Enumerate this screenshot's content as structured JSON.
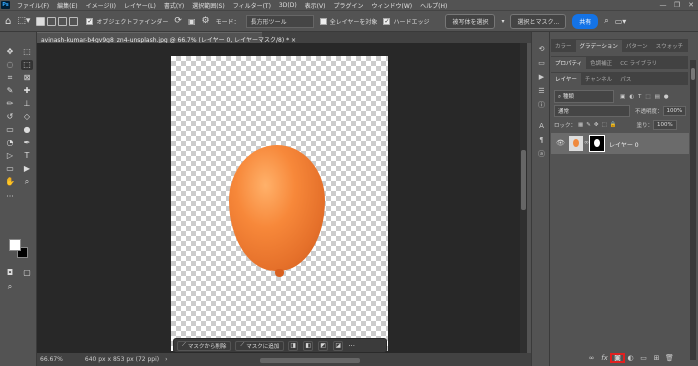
{
  "menu": {
    "logo": "Ps",
    "items": [
      "ファイル(F)",
      "編集(E)",
      "イメージ(I)",
      "レイヤー(L)",
      "書式(Y)",
      "選択範囲(S)",
      "フィルター(T)",
      "3D(D)",
      "表示(V)",
      "プラグイン",
      "ウィンドウ(W)",
      "ヘルプ(H)"
    ],
    "min": "—",
    "max": "❐",
    "close": "✕"
  },
  "options": {
    "object_finder": "オブジェクトファインダー",
    "mode_label": "モード：",
    "mode_value": "長方形ツール",
    "all_layers": "全レイヤーを対象",
    "hard_edge": "ハードエッジ",
    "select_subject": "被写体を選択",
    "select_mask": "選択とマスク...",
    "share": "共有"
  },
  "document": {
    "tab_title": "avinash-kumar-b4gv9g8_zn4-unsplash.jpg @ 66.7% (レイヤー 0, レイヤーマスク/8) *",
    "close": "×"
  },
  "mask_tools": {
    "subtract": "マスクから削除",
    "add": "マスクに追加",
    "more": "···"
  },
  "status": {
    "zoom": "66.67%",
    "doc_size": "640 px x 853 px (72 ppi)"
  },
  "panels": {
    "top_tabs": [
      "カラー",
      "グラデーション",
      "パターン",
      "スウォッチ"
    ],
    "mid_tabs": [
      "プロパティ",
      "色調補正",
      "CC ライブラリ"
    ],
    "layer_tabs": [
      "レイヤー",
      "チャンネル",
      "パス"
    ],
    "kind_label": "種類",
    "blend_mode": "通常",
    "opacity_label": "不透明度：",
    "opacity_value": "100%",
    "lock_label": "ロック：",
    "fill_label": "塗り：",
    "fill_value": "100%",
    "layer_name": "レイヤー 0"
  },
  "colors": {
    "accent": "#1473e6",
    "balloon": "#f08a3e",
    "highlight": "#e02020"
  }
}
